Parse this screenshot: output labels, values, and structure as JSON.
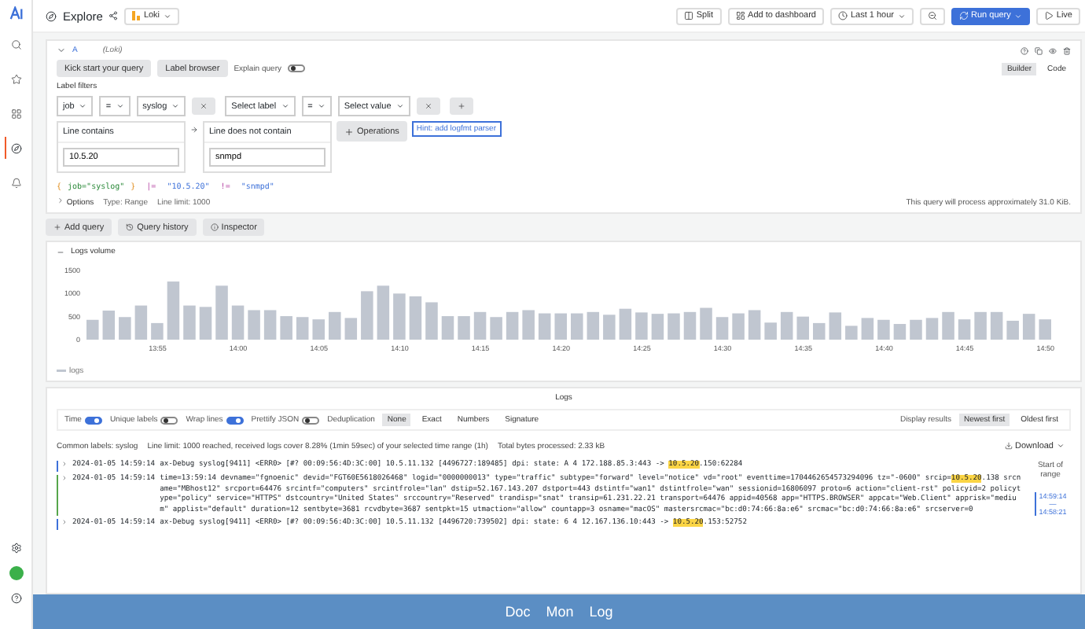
{
  "sidebar": {
    "items": [
      {
        "kind": "search",
        "selected": false
      },
      {
        "kind": "star",
        "selected": false
      },
      {
        "kind": "grid",
        "selected": false
      },
      {
        "kind": "explore",
        "selected": true
      },
      {
        "kind": "bell",
        "selected": false
      }
    ]
  },
  "header": {
    "title": "Explore",
    "datasource": "Loki",
    "buttons": [
      {
        "label": "Split",
        "kind": "split"
      },
      {
        "label": "Add to dashboard",
        "kind": "dashboard"
      },
      {
        "label": "Last 1 hour",
        "kind": "time"
      },
      {
        "label": "Run query",
        "kind": "run"
      },
      {
        "label": "Live",
        "kind": "live"
      }
    ]
  },
  "query": {
    "letter": "A",
    "datasource": "(Loki)",
    "actions": [
      "Kick start your query",
      "Label browser"
    ],
    "explain": {
      "label": "Explain query",
      "on": false
    },
    "modes": [
      {
        "label": "Builder",
        "selected": true
      },
      {
        "label": "Code",
        "selected": false
      }
    ],
    "filters_label": "Label filters",
    "filters": [
      {
        "label": "job",
        "op": "=",
        "value": "syslog"
      },
      {
        "label": "Select label",
        "op": "=",
        "value": "Select value"
      }
    ],
    "operations": [
      {
        "name": "Line contains",
        "value": "10.5.20"
      },
      {
        "name": "Line does not contain",
        "value": "snmpd"
      }
    ],
    "add_operation": "Operations",
    "hint": "Hint: add logfmt parser",
    "preview": [
      {
        "text": "{",
        "kind": "brace"
      },
      {
        "text": "job=\"syslog\"",
        "kind": "label"
      },
      {
        "text": "}",
        "kind": "brace"
      },
      {
        "text": " |= ",
        "kind": "op"
      },
      {
        "text": "\"10.5.20\"",
        "kind": "string"
      },
      {
        "text": " != ",
        "kind": "op"
      },
      {
        "text": "\"snmpd\"",
        "kind": "string"
      }
    ],
    "options": {
      "label": "Options",
      "type": "Type: Range",
      "limit": "Line limit: 1000"
    },
    "estimate": "This query will process approximately 31.0 KiB."
  },
  "query_actions": [
    {
      "label": "Add query",
      "kind": "add"
    },
    {
      "label": "Query history",
      "kind": "history"
    },
    {
      "label": "Inspector",
      "kind": "inspector"
    }
  ],
  "logs_volume": {
    "title": "Logs volume",
    "chart_data": {
      "type": "bar",
      "categories": [
        null,
        null,
        null,
        null,
        "13:55",
        null,
        null,
        null,
        null,
        "14:00",
        null,
        null,
        null,
        null,
        "14:05",
        null,
        null,
        null,
        null,
        "14:10",
        null,
        null,
        null,
        null,
        "14:15",
        null,
        null,
        null,
        null,
        "14:20",
        null,
        null,
        null,
        null,
        "14:25",
        null,
        null,
        null,
        null,
        "14:30",
        null,
        null,
        null,
        null,
        "14:35",
        null,
        null,
        null,
        null,
        "14:40",
        null,
        null,
        null,
        null,
        "14:45",
        null,
        null,
        null,
        null,
        "14:50"
      ],
      "series": [
        {
          "name": "logs",
          "color": "#c0c6d0",
          "values": [
            430,
            630,
            490,
            740,
            360,
            1260,
            740,
            710,
            1170,
            740,
            640,
            640,
            510,
            490,
            440,
            600,
            470,
            1050,
            1170,
            1000,
            940,
            810,
            510,
            510,
            600,
            490,
            600,
            640,
            570,
            570,
            570,
            600,
            540,
            670,
            590,
            560,
            570,
            600,
            690,
            490,
            570,
            640,
            370,
            600,
            500,
            360,
            590,
            300,
            470,
            430,
            340,
            430,
            470,
            600,
            440,
            600,
            600,
            410,
            560,
            440
          ]
        }
      ],
      "ylim": [
        0,
        1500
      ],
      "yticks": [
        0,
        500,
        1000,
        1500
      ]
    }
  },
  "logs": {
    "title": "Logs",
    "toggles": [
      {
        "label": "Time",
        "on": true
      },
      {
        "label": "Unique labels",
        "on": false
      },
      {
        "label": "Wrap lines",
        "on": true
      },
      {
        "label": "Prettify JSON",
        "on": false
      }
    ],
    "dedup_label": "Deduplication",
    "dedup": [
      {
        "label": "None",
        "selected": true
      },
      {
        "label": "Exact",
        "selected": false
      },
      {
        "label": "Numbers",
        "selected": false
      },
      {
        "label": "Signature",
        "selected": false
      }
    ],
    "order_label": "Display results",
    "order": [
      {
        "label": "Newest first",
        "selected": true
      },
      {
        "label": "Oldest first",
        "selected": false
      }
    ],
    "meta": [
      "Common labels: syslog",
      "Line limit: 1000 reached, received logs cover 8.28% (1min 59sec) of your selected time range (1h)",
      "Total bytes processed: 2.33 kB"
    ],
    "download": "Download",
    "rows": [
      {
        "time": "2024-01-05 14:59:14",
        "color": "#3d71d9",
        "segments": [
          {
            "text": "ax-Debug syslog[9411] <ERR0> [#? 00:09:56:4D:3C:00] 10.5.11.132 [4496727:189485] dpi: state: A 4 172.188.85.3:443 -> ",
            "highlighted": false
          },
          {
            "text": "10.5.20",
            "highlighted": true
          },
          {
            "text": ".150:62284",
            "highlighted": false
          }
        ]
      },
      {
        "time": "2024-01-05 14:59:14",
        "color": "#56a64b",
        "segments": [
          {
            "text": "time=13:59:14 devname=\"fgnoenic\" devid=\"FGT60E5618026468\" logid=\"0000000013\" type=\"traffic\" subtype=\"forward\" level=\"notice\" vd=\"root\" eventtime=1704462654573294096 tz=\"-0600\" srcip=",
            "highlighted": false
          },
          {
            "text": "10.5.20",
            "highlighted": true
          },
          {
            "text": ".138 srcname=\"MBhost12\" srcport=64476 srcintf=\"computers\" srcintfrole=\"lan\" dstip=52.167.143.207 dstport=443 dstintf=\"wan1\" dstintfrole=\"wan\" sessionid=16806097 proto=6 action=\"client-rst\" policyid=2 policytype=\"policy\" service=\"HTTPS\" dstcountry=\"United States\" srccountry=\"Reserved\" trandisp=\"snat\" transip=61.231.22.21 transport=64476 appid=40568 app=\"HTTPS.BROWSER\" appcat=\"Web.Client\" apprisk=\"medium\" applist=\"default\" duration=12 sentbyte=3681 rcvdbyte=3687 sentpkt=15 utmaction=\"allow\" countapp=3 osname=\"macOS\" mastersrcmac=\"bc:d0:74:66:8a:e6\" srcmac=\"bc:d0:74:66:8a:e6\" srcserver=0",
            "highlighted": false
          }
        ]
      },
      {
        "time": "2024-01-05 14:59:14",
        "color": "#3d71d9",
        "segments": [
          {
            "text": "ax-Debug syslog[9411] <ERR0> [#? 00:09:56:4D:3C:00] 10.5.11.132 [4496720:739502] dpi: state: 6 4 12.167.136.10:443 -> ",
            "highlighted": false
          },
          {
            "text": "10.5.20",
            "highlighted": true
          },
          {
            "text": ".153:52752",
            "highlighted": false
          }
        ]
      }
    ],
    "range": {
      "label": "Start of range",
      "from": "14:59:14",
      "separator": "—",
      "to": "14:58:21"
    }
  },
  "footer": [
    "Doc",
    "Mon",
    "Log"
  ]
}
